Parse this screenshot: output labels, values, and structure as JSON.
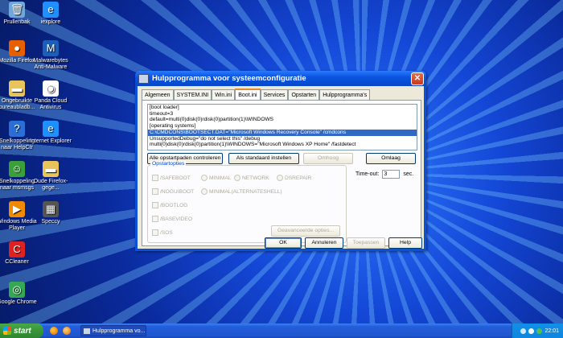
{
  "desktop_icons": [
    {
      "label": "Prullenbak",
      "icon": "recycle-bin-icon",
      "glyph": "🗑",
      "bg": "#6fa8dc"
    },
    {
      "label": "iexplore",
      "icon": "internet-explorer-icon",
      "glyph": "e",
      "bg": "#1e90ff"
    },
    {
      "label": "Mozilla Firefox",
      "icon": "firefox-icon",
      "glyph": "●",
      "bg": "#e66000"
    },
    {
      "label": "Malwarebytes Anti-Malware",
      "icon": "malwarebytes-icon",
      "glyph": "M",
      "bg": "#1c5fb8"
    },
    {
      "label": "Ongebruikte bureaubladb...",
      "icon": "folder-icon",
      "glyph": "▬",
      "bg": "#e8c45a"
    },
    {
      "label": "Panda Cloud Antivirus",
      "icon": "panda-icon",
      "glyph": "◉",
      "bg": "#ffffff"
    },
    {
      "label": "Snelkoppeling naar HelpCtr",
      "icon": "help-icon",
      "glyph": "?",
      "bg": "#2b6fd6"
    },
    {
      "label": "Internet Explorer",
      "icon": "internet-explorer-icon",
      "glyph": "e",
      "bg": "#1e90ff"
    },
    {
      "label": "Snelkoppeling naar msmsgs",
      "icon": "messenger-icon",
      "glyph": "☺",
      "bg": "#3aa03a"
    },
    {
      "label": "Oude Firefox-gege...",
      "icon": "folder-icon",
      "glyph": "▬",
      "bg": "#e8c45a"
    },
    {
      "label": "Windows Media Player",
      "icon": "media-player-icon",
      "glyph": "▶",
      "bg": "#f08a00"
    },
    {
      "label": "Speccy",
      "icon": "speccy-icon",
      "glyph": "▦",
      "bg": "#555555"
    },
    {
      "label": "CCleaner",
      "icon": "ccleaner-icon",
      "glyph": "C",
      "bg": "#d22"
    },
    {
      "label": "Google Chrome",
      "icon": "chrome-icon",
      "glyph": "◎",
      "bg": "#34a853"
    }
  ],
  "window": {
    "title": "Hulpprogramma voor systeemconfiguratie",
    "close_glyph": "✕",
    "tabs": [
      {
        "label": "Algemeen"
      },
      {
        "label": "SYSTEM.INI"
      },
      {
        "label": "Win.ini"
      },
      {
        "label": "Boot.ini"
      },
      {
        "label": "Services"
      },
      {
        "label": "Opstarten"
      },
      {
        "label": "Hulpprogramma's"
      }
    ],
    "active_tab": "Boot.ini",
    "boot_lines": [
      "[boot loader]",
      "timeout=3",
      "default=multi(0)disk(0)rdisk(0)partition(1)\\WINDOWS",
      "[operating systems]",
      "C:\\CMDCONS\\BOOTSECT.DAT=\"Microsoft Windows Recovery Console\" /cmdcons",
      "UnsupportedDebug=\"do not select this\" /debug",
      "multi(0)disk(0)rdisk(0)partition(1)\\WINDOWS=\"Microsoft Windows XP Home\" /fastdetect"
    ],
    "selected_line": "C:\\CMDCONS\\BOOTSECT.DAT=\"Microsoft Windows Recovery Console\" /cmdcons",
    "buttons": {
      "check_paths": "Alle opstartpaden controleren",
      "set_default": "Als standaard instellen",
      "move_up": "Omhoog",
      "move_down": "Omlaag",
      "advanced": "Geavanceerde opties...",
      "ok": "OK",
      "cancel": "Annuleren",
      "apply": "Toepassen",
      "help": "Help"
    },
    "options_legend": "Opstartopties",
    "options": {
      "safeboot": "/SAFEBOOT",
      "minimal": "MINIMAL",
      "network": "NETWORK",
      "dsrepair": "DSREPAIR",
      "noguiboot": "/NOGUIBOOT",
      "minimal_alt": "MINIMAL(ALTERNATESHELL)",
      "bootlog": "/BOOTLOG",
      "basevideo": "/BASEVIDEO",
      "sos": "/SOS"
    },
    "timeout_label": "Time-out:",
    "timeout_value": "3",
    "timeout_unit": "sec."
  },
  "taskbar": {
    "start_label": "start",
    "task_label": "Hulpprogramma vo...",
    "clock": "22:01"
  }
}
